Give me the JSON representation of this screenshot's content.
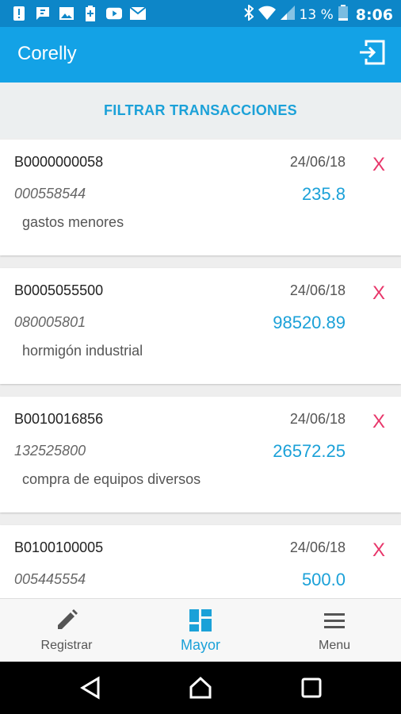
{
  "status_bar": {
    "battery_percent": "13 %",
    "time": "8:06",
    "icons": [
      "alert-icon",
      "message-icon",
      "image-icon",
      "battery-saver-icon",
      "youtube-icon",
      "gmail-icon",
      "bluetooth-icon",
      "wifi-icon",
      "signal-icon",
      "battery-icon"
    ]
  },
  "app_bar": {
    "title": "Corelly",
    "logout_icon": "logout-icon"
  },
  "filter": {
    "label": "FILTRAR TRANSACCIONES"
  },
  "transactions": [
    {
      "code": "B0000000058",
      "date": "24/06/18",
      "reference": "000558544",
      "amount": "235.8",
      "description": "gastos menores",
      "delete_label": "X"
    },
    {
      "code": "B0005055500",
      "date": "24/06/18",
      "reference": "080005801",
      "amount": "98520.89",
      "description": "hormigón industrial",
      "delete_label": "X"
    },
    {
      "code": "B0010016856",
      "date": "24/06/18",
      "reference": "132525800",
      "amount": "26572.25",
      "description": "compra de equipos diversos",
      "delete_label": "X"
    },
    {
      "code": "B0100100005",
      "date": "24/06/18",
      "reference": "005445554",
      "amount": "500.0",
      "description": "",
      "delete_label": "X"
    }
  ],
  "bottom_nav": {
    "items": [
      {
        "label": "Registrar",
        "icon": "pencil-icon",
        "active": false
      },
      {
        "label": "Mayor",
        "icon": "dashboard-icon",
        "active": true
      },
      {
        "label": "Menu",
        "icon": "hamburger-icon",
        "active": false
      }
    ]
  },
  "colors": {
    "primary": "#13a2e6",
    "status_bar": "#0d86c8",
    "accent": "#1ba1d8",
    "delete": "#e8366a"
  }
}
